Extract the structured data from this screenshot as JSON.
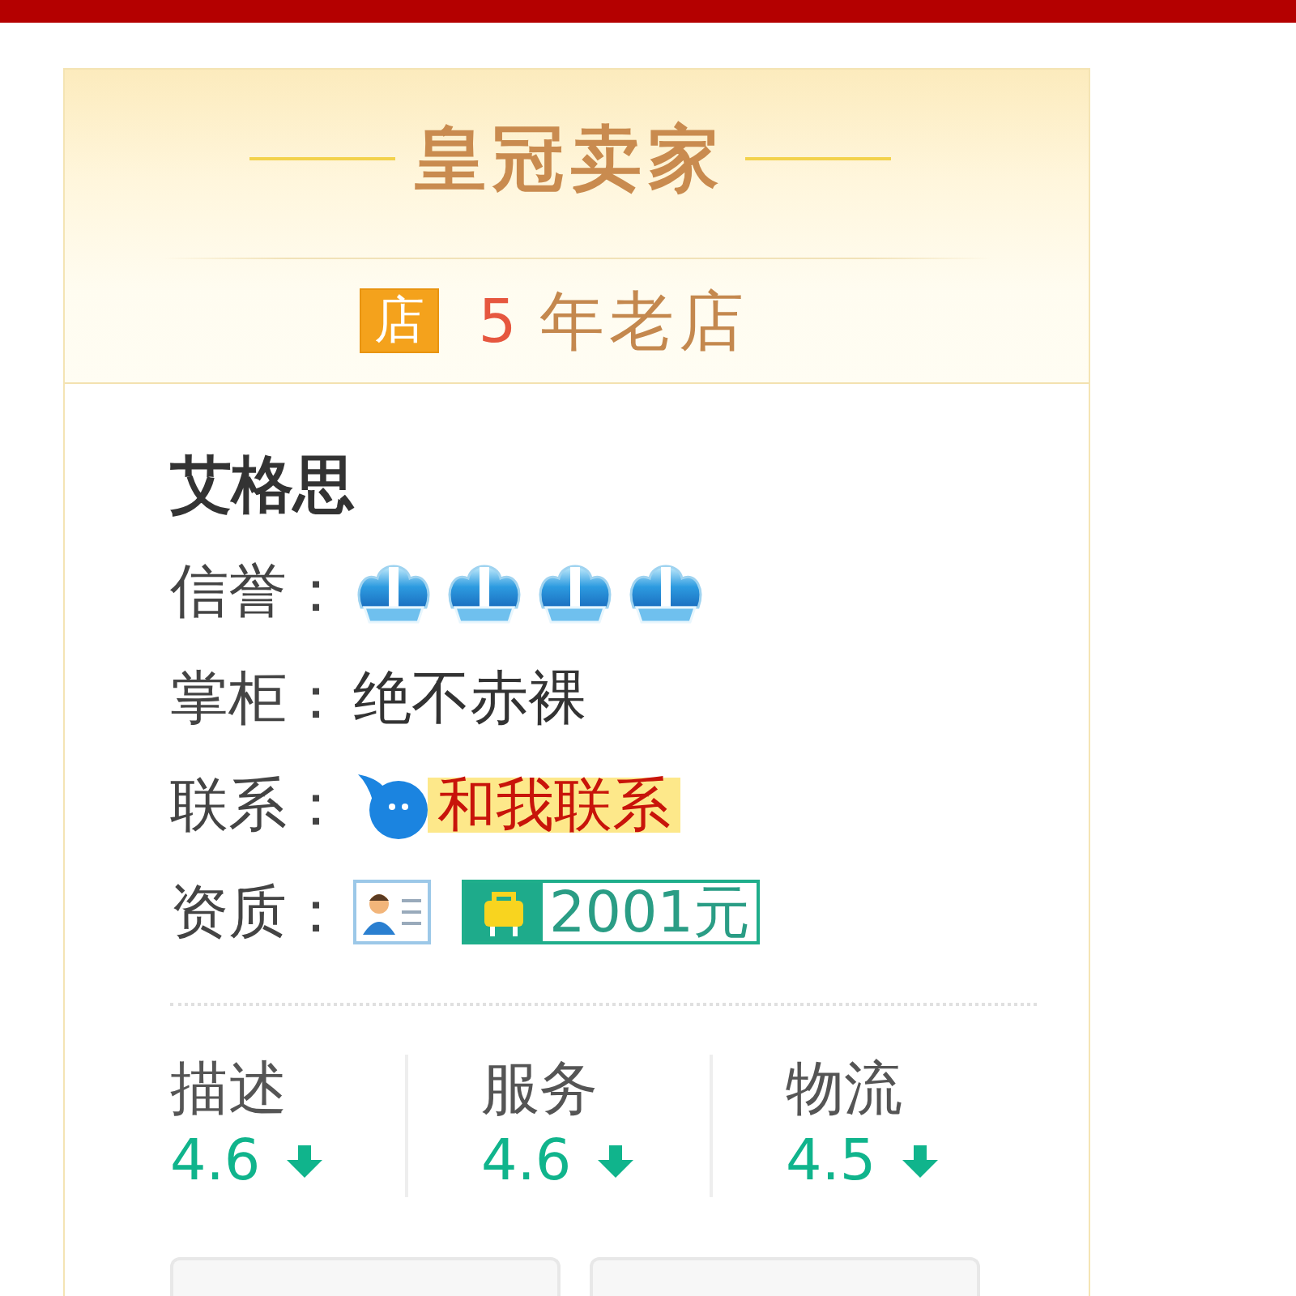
{
  "header": {
    "title": "皇冠卖家",
    "shop_badge": "店",
    "shop_age_number": "5",
    "shop_age_label": "年老店"
  },
  "seller": {
    "name": "艾格思",
    "reputation": {
      "label": "信誉：",
      "stars": 4
    },
    "owner": {
      "label": "掌柜：",
      "value": "绝不赤裸"
    },
    "contact": {
      "label": "联系：",
      "button": "和我联系"
    },
    "qualification": {
      "label": "资质：",
      "deposit": "2001元"
    }
  },
  "ratings": [
    {
      "label": "描述",
      "score": "4.6",
      "below_average": true
    },
    {
      "label": "服务",
      "score": "4.6",
      "below_average": true
    },
    {
      "label": "物流",
      "score": "4.5",
      "below_average": true
    }
  ]
}
